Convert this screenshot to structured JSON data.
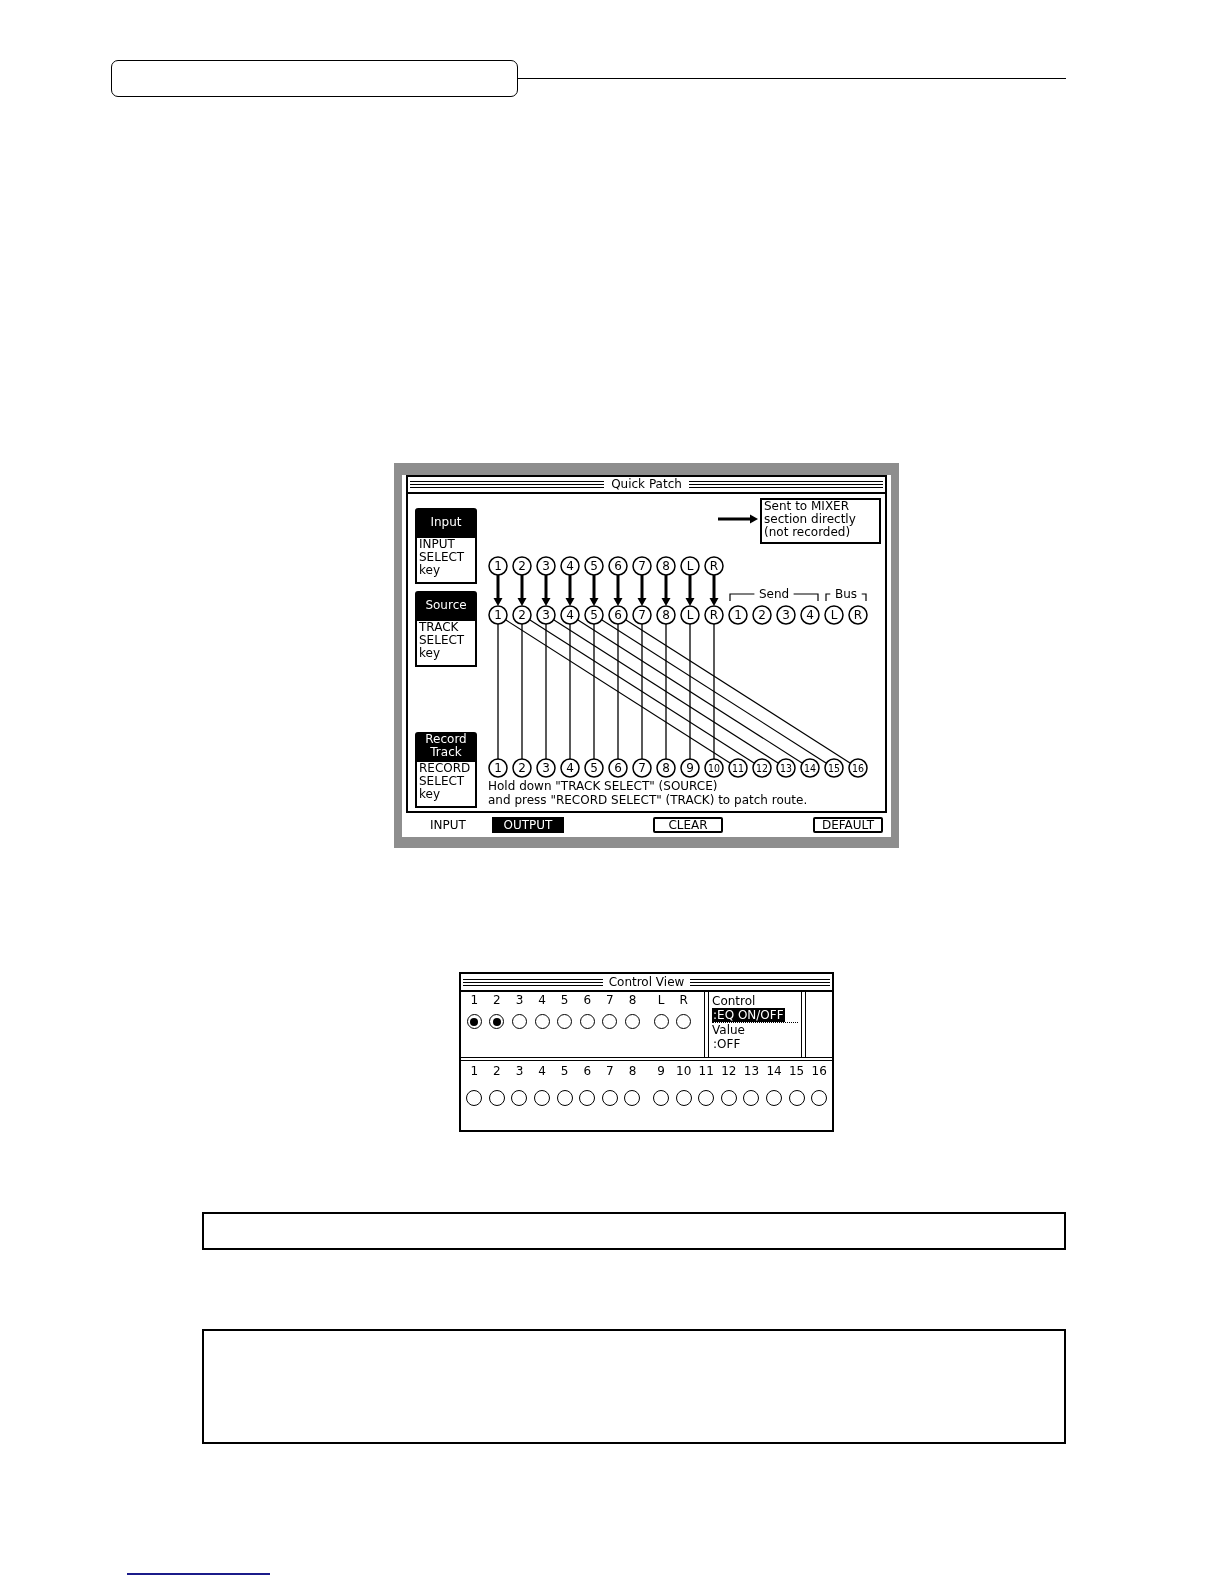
{
  "quick_patch": {
    "title": "Quick Patch",
    "legend": "Sent to MIXER\nsection directly\n(not recorded)",
    "side_labels": [
      {
        "heading": "Input",
        "keys": "INPUT\nSELECT\nkey"
      },
      {
        "heading": "Source",
        "keys": "TRACK\nSELECT\nkey"
      },
      {
        "heading": "Record\nTrack",
        "keys": "RECORD\nSELECT\nkey"
      }
    ],
    "input_nodes": [
      "1",
      "2",
      "3",
      "4",
      "5",
      "6",
      "7",
      "8",
      "L",
      "R"
    ],
    "send_label": "Send",
    "bus_label": "Bus",
    "source_nodes": [
      "1",
      "2",
      "3",
      "4",
      "5",
      "6",
      "7",
      "8",
      "L",
      "R"
    ],
    "send_nodes": [
      "1",
      "2",
      "3",
      "4"
    ],
    "bus_nodes": [
      "L",
      "R"
    ],
    "track_nodes": [
      "1",
      "2",
      "3",
      "4",
      "5",
      "6",
      "7",
      "8",
      "9",
      "10",
      "11",
      "12",
      "13",
      "14",
      "15",
      "16"
    ],
    "instruction": "Hold down \"TRACK SELECT\" (SOURCE)\nand press \"RECORD SELECT\" (TRACK) to patch route.",
    "soft_keys": [
      {
        "label": "INPUT",
        "kind": "tab",
        "selected": false
      },
      {
        "label": "OUTPUT",
        "kind": "tab",
        "selected": true
      },
      {
        "label": "CLEAR",
        "kind": "button"
      },
      {
        "label": "DEFAULT",
        "kind": "button"
      }
    ]
  },
  "control_view": {
    "title": "Control View",
    "inputs": [
      {
        "label": "1",
        "on": true
      },
      {
        "label": "2",
        "on": true
      },
      {
        "label": "3",
        "on": false
      },
      {
        "label": "4",
        "on": false
      },
      {
        "label": "5",
        "on": false
      },
      {
        "label": "6",
        "on": false
      },
      {
        "label": "7",
        "on": false
      },
      {
        "label": "8",
        "on": false
      },
      {
        "label": "L",
        "on": false
      },
      {
        "label": "R",
        "on": false
      }
    ],
    "control": {
      "label": "Control",
      "value": ":EQ ON/OFF",
      "highlighted": true
    },
    "value": {
      "label": "Value",
      "value": ":OFF",
      "highlighted": false
    },
    "tracks": [
      {
        "label": "1",
        "on": false
      },
      {
        "label": "2",
        "on": false
      },
      {
        "label": "3",
        "on": false
      },
      {
        "label": "4",
        "on": false
      },
      {
        "label": "5",
        "on": false
      },
      {
        "label": "6",
        "on": false
      },
      {
        "label": "7",
        "on": false
      },
      {
        "label": "8",
        "on": false
      },
      {
        "label": "9",
        "on": false
      },
      {
        "label": "10",
        "on": false
      },
      {
        "label": "11",
        "on": false
      },
      {
        "label": "12",
        "on": false
      },
      {
        "label": "13",
        "on": false
      },
      {
        "label": "14",
        "on": false
      },
      {
        "label": "15",
        "on": false
      },
      {
        "label": "16",
        "on": false
      }
    ]
  }
}
